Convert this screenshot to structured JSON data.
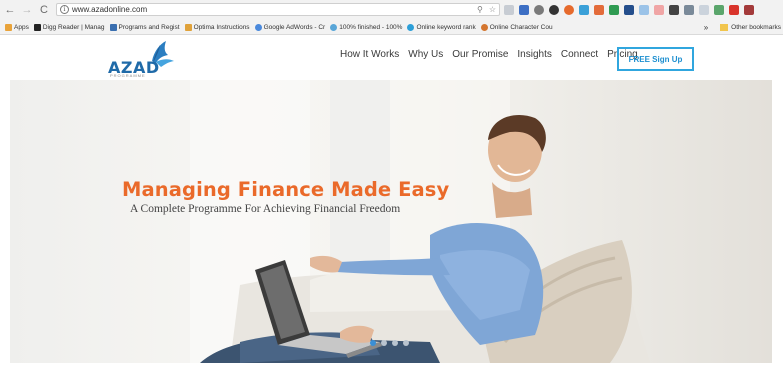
{
  "browser": {
    "url": "www.azadonline.com",
    "bookmarks": [
      {
        "label": "Apps",
        "color": "#e9a33a"
      },
      {
        "label": "Digg Reader | Manag",
        "color": "#222222"
      },
      {
        "label": "Programs and Regist",
        "color": "#3a6fb0"
      },
      {
        "label": "Optima Instructions",
        "color": "#e0a23a"
      },
      {
        "label": "Google AdWords - Cr",
        "color": "#4a89dc"
      },
      {
        "label": "100% finished - 100%",
        "color": "#59a6d8"
      },
      {
        "label": "Online keyword rank",
        "color": "#2c9fd8"
      },
      {
        "label": "Online Character Cou",
        "color": "#d4762f"
      }
    ],
    "overflow_label": "»",
    "other_bookmarks_label": "Other bookmarks"
  },
  "site": {
    "logo_text": "AZAD",
    "logo_subtitle": "PROGRAMME",
    "nav": [
      "How It Works",
      "Why Us",
      "Our Promise",
      "Insights",
      "Connect",
      "Pricing"
    ],
    "signup_label": "FREE Sign Up"
  },
  "hero": {
    "title": "Managing Finance Made Easy",
    "subtitle": "A Complete Programme For Achieving Financial Freedom",
    "slides": 4,
    "active_slide": 1
  },
  "colors": {
    "accent": "#ea6a2a",
    "brand": "#1f6aa8",
    "signup_border": "#30a6de"
  }
}
